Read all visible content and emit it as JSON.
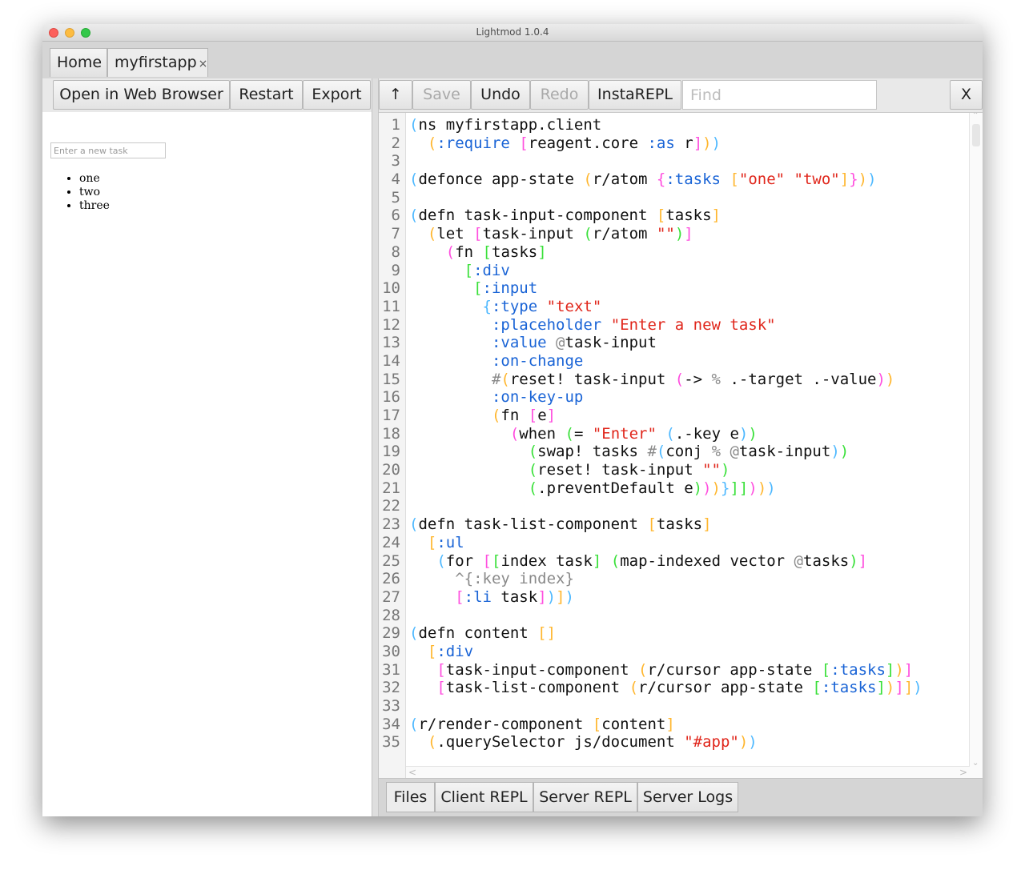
{
  "window": {
    "title": "Lightmod 1.0.4"
  },
  "tabs": [
    {
      "label": "Home"
    },
    {
      "label": "myfirstapp",
      "close": "×"
    }
  ],
  "left_toolbar": {
    "open_browser": "Open in Web Browser",
    "restart": "Restart",
    "export": "Export"
  },
  "app_preview": {
    "input_placeholder": "Enter a new task",
    "tasks": [
      "one",
      "two",
      "three"
    ]
  },
  "editor_toolbar": {
    "up": "↑",
    "save": "Save",
    "undo": "Undo",
    "redo": "Redo",
    "instarepl": "InstaREPL",
    "find_placeholder": "Find",
    "close": "X"
  },
  "code": {
    "lines": [
      [
        [
          "p1",
          "("
        ],
        [
          "",
          "ns myfirstapp.client"
        ]
      ],
      [
        [
          "",
          "  "
        ],
        [
          "p2",
          "("
        ],
        [
          "kw",
          ":require"
        ],
        [
          "",
          ""
        ],
        [
          "",
          "  "
        ],
        [
          "",
          ""
        ]
      ],
      [],
      [
        [
          "p1",
          "("
        ],
        [
          "",
          "defonce app-state "
        ],
        [
          "p2",
          "("
        ],
        [
          "",
          "r/atom "
        ],
        [
          "p3",
          "{"
        ],
        [
          "kw",
          ":tasks"
        ],
        [
          "",
          ""
        ]
      ],
      [],
      [
        [
          "p1",
          "("
        ],
        [
          "",
          "defn task-input-component "
        ],
        [
          "p2",
          "["
        ],
        [
          "",
          "tasks"
        ],
        [
          "p2",
          "]"
        ]
      ],
      [
        [
          "",
          "  "
        ],
        [
          "p2",
          "("
        ],
        [
          "",
          "let "
        ],
        [
          "p3",
          "["
        ],
        [
          "",
          "task-input "
        ],
        [
          "p4",
          "("
        ],
        [
          "",
          "r/atom "
        ],
        [
          "str",
          "\"\""
        ],
        [
          "p4",
          ")"
        ],
        [
          "p3",
          "]"
        ]
      ],
      [
        [
          "",
          "    "
        ],
        [
          "p3",
          "("
        ],
        [
          "",
          "fn "
        ],
        [
          "p4",
          "["
        ],
        [
          "",
          "tasks"
        ],
        [
          "p4",
          "]"
        ]
      ],
      [
        [
          "",
          "      "
        ],
        [
          "p4",
          "["
        ],
        [
          "kw",
          ":div"
        ]
      ],
      [
        [
          "",
          "       "
        ],
        [
          "p4",
          "["
        ],
        [
          "kw",
          ":input"
        ]
      ],
      [
        [
          "",
          "        "
        ],
        [
          "p1",
          "{"
        ],
        [
          "kw",
          ":type"
        ],
        [
          "",
          " "
        ],
        [
          "str",
          "\"text\""
        ]
      ],
      [
        [
          "",
          "         "
        ],
        [
          "kw",
          ":placeholder"
        ],
        [
          "",
          " "
        ],
        [
          "str",
          "\"Enter a new task\""
        ]
      ],
      [
        [
          "",
          "         "
        ],
        [
          "kw",
          ":value"
        ],
        [
          "",
          " "
        ],
        [
          "dim",
          "@"
        ],
        [
          "",
          "task-input"
        ]
      ],
      [
        [
          "",
          "         "
        ],
        [
          "kw",
          ":on-change"
        ]
      ],
      [
        [
          "",
          "         "
        ],
        [
          "dim",
          "#"
        ],
        [
          "p2",
          "("
        ],
        [
          "",
          "reset! task-input "
        ],
        [
          "p3",
          "("
        ],
        [
          "",
          "-> "
        ],
        [
          "dim",
          "%"
        ],
        [
          "",
          " .-target .-value"
        ],
        [
          "p3",
          ")"
        ],
        [
          "p2",
          ")"
        ]
      ],
      [
        [
          "",
          "         "
        ],
        [
          "kw",
          ":on-key-up"
        ]
      ],
      [
        [
          "",
          "         "
        ],
        [
          "p2",
          "("
        ],
        [
          "",
          "fn "
        ],
        [
          "p3",
          "["
        ],
        [
          "",
          "e"
        ],
        [
          "p3",
          "]"
        ]
      ],
      [
        [
          "",
          "           "
        ],
        [
          "p3",
          "("
        ],
        [
          "",
          "when "
        ],
        [
          "p4",
          "("
        ],
        [
          "",
          "= "
        ],
        [
          "str",
          "\"Enter\""
        ],
        [
          "",
          " "
        ],
        [
          "p1",
          "("
        ],
        [
          "",
          ".-key e"
        ],
        [
          "p1",
          ")"
        ],
        [
          "p4",
          ")"
        ]
      ],
      [
        [
          "",
          "             "
        ],
        [
          "p4",
          "("
        ],
        [
          "",
          "swap! tasks "
        ],
        [
          "dim",
          "#"
        ],
        [
          "p1",
          "("
        ],
        [
          "",
          "conj "
        ],
        [
          "dim",
          "%"
        ],
        [
          "",
          " "
        ],
        [
          "dim",
          "@"
        ],
        [
          "",
          "task-input"
        ],
        [
          "p1",
          ")"
        ],
        [
          "p4",
          ")"
        ]
      ],
      [
        [
          "",
          "             "
        ],
        [
          "p4",
          "("
        ],
        [
          "",
          "reset! task-input "
        ],
        [
          "str",
          "\"\""
        ],
        [
          "p4",
          ")"
        ]
      ],
      [
        [
          "",
          "             "
        ],
        [
          "p4",
          "("
        ],
        [
          "",
          ".preventDefault e"
        ],
        [
          "p4",
          ")"
        ],
        [
          "p3",
          ")"
        ],
        [
          "p2",
          ")"
        ],
        [
          "p1",
          "}"
        ],
        [
          "p4",
          "]"
        ],
        [
          "p4",
          "]"
        ],
        [
          "p3",
          ")"
        ],
        [
          "p2",
          ")"
        ],
        [
          "p1",
          ")"
        ]
      ],
      [],
      [
        [
          "p1",
          "("
        ],
        [
          "",
          "defn task-list-component "
        ],
        [
          "p2",
          "["
        ],
        [
          "",
          "tasks"
        ],
        [
          "p2",
          "]"
        ]
      ],
      [
        [
          "",
          "  "
        ],
        [
          "p2",
          "["
        ],
        [
          "kw",
          ":ul"
        ]
      ],
      [
        [
          "",
          "   "
        ],
        [
          "p1",
          "("
        ],
        [
          "",
          "for "
        ],
        [
          "p3",
          "["
        ],
        [
          "p4",
          "["
        ],
        [
          "",
          "index task"
        ],
        [
          "p4",
          "]"
        ],
        [
          "",
          " "
        ],
        [
          "p4",
          "("
        ],
        [
          "",
          "map-indexed vector "
        ],
        [
          "dim",
          "@"
        ],
        [
          "",
          "tasks"
        ],
        [
          "p4",
          ")"
        ],
        [
          "p3",
          "]"
        ]
      ],
      [
        [
          "",
          "     "
        ],
        [
          "dim",
          "^{:key index}"
        ]
      ],
      [
        [
          "",
          "     "
        ],
        [
          "p3",
          "["
        ],
        [
          "kw",
          ":li"
        ],
        [
          "",
          " task"
        ],
        [
          "p3",
          "]"
        ],
        [
          "p1",
          ")"
        ],
        [
          "p2",
          "]"
        ],
        [
          "p1",
          ")"
        ]
      ],
      [],
      [
        [
          "p1",
          "("
        ],
        [
          "",
          "defn content "
        ],
        [
          "p2",
          "[]"
        ]
      ],
      [
        [
          "",
          "  "
        ],
        [
          "p2",
          "["
        ],
        [
          "kw",
          ":div"
        ]
      ],
      [
        [
          "",
          "   "
        ],
        [
          "p3",
          "["
        ],
        [
          "",
          "task-input-component "
        ],
        [
          "p2",
          "("
        ],
        [
          "",
          "r/cursor app-state "
        ],
        [
          "p4",
          "["
        ],
        [
          "kw",
          ":tasks"
        ],
        [
          "p4",
          "]"
        ],
        [
          "p2",
          ")"
        ],
        [
          "p3",
          "]"
        ]
      ],
      [
        [
          "",
          "   "
        ],
        [
          "p3",
          "["
        ],
        [
          "",
          "task-list-component "
        ],
        [
          "p2",
          "("
        ],
        [
          "",
          "r/cursor app-state "
        ],
        [
          "p4",
          "["
        ],
        [
          "kw",
          ":tasks"
        ],
        [
          "p4",
          "]"
        ],
        [
          "p2",
          ")"
        ],
        [
          "p3",
          "]"
        ],
        [
          "p2",
          "]"
        ],
        [
          "p1",
          ")"
        ]
      ],
      [],
      [
        [
          "p1",
          "("
        ],
        [
          "",
          "r/render-component "
        ],
        [
          "p2",
          "["
        ],
        [
          "",
          "content"
        ],
        [
          "p2",
          "]"
        ]
      ],
      [
        [
          "",
          "  "
        ],
        [
          "p2",
          "("
        ],
        [
          "",
          ".querySelector js/document "
        ],
        [
          "str",
          "\"#app\""
        ],
        [
          "p2",
          ")"
        ],
        [
          "p1",
          ")"
        ]
      ]
    ]
  },
  "code_fix": {
    "2": [
      [
        "",
        "  "
      ],
      [
        "p2",
        "("
      ],
      [
        "kw",
        ":require"
      ],
      [
        "",
        " "
      ],
      [
        "p3",
        "["
      ],
      [
        "",
        "reagent.core "
      ],
      [
        "kw",
        ":as"
      ],
      [
        "",
        " r"
      ],
      [
        "p3",
        "]"
      ],
      [
        "p2",
        ")"
      ],
      [
        "p1",
        ")"
      ]
    ],
    "4": [
      [
        "p1",
        "("
      ],
      [
        "",
        "defonce app-state "
      ],
      [
        "p2",
        "("
      ],
      [
        "",
        "r/atom "
      ],
      [
        "p3",
        "{"
      ],
      [
        "kw",
        ":tasks"
      ],
      [
        "",
        " "
      ],
      [
        "p2",
        "["
      ],
      [
        "str",
        "\"one\""
      ],
      [
        "",
        " "
      ],
      [
        "str",
        "\"two\""
      ],
      [
        "p2",
        "]"
      ],
      [
        "p3",
        "}"
      ],
      [
        "p2",
        ")"
      ],
      [
        "p1",
        ")"
      ]
    ]
  },
  "bottom_tabs": [
    "Files",
    "Client REPL",
    "Server REPL",
    "Server Logs"
  ],
  "scroll": {
    "up": "⌃",
    "down": "⌄",
    "left": "<",
    "right": ">"
  }
}
